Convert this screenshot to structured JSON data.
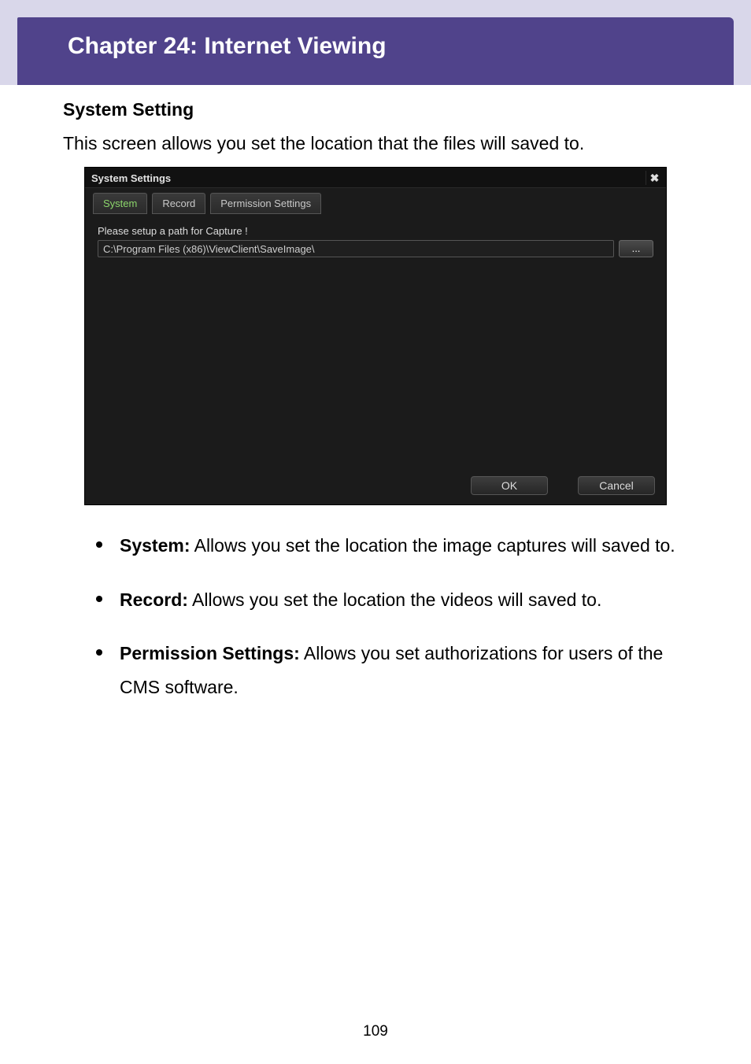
{
  "chapter": {
    "title": "Chapter 24: Internet Viewing"
  },
  "section": {
    "heading": "System Setting",
    "intro": "This screen allows you set the location that the files will saved to."
  },
  "dialog": {
    "title": "System Settings",
    "close_glyph": "✖",
    "tabs": [
      {
        "label": "System",
        "active": true
      },
      {
        "label": "Record",
        "active": false
      },
      {
        "label": "Permission Settings",
        "active": false
      }
    ],
    "capture_label": "Please setup a path for Capture !",
    "path_value": "C:\\Program Files (x86)\\ViewClient\\SaveImage\\",
    "browse_label": "...",
    "ok_label": "OK",
    "cancel_label": "Cancel"
  },
  "bullets": [
    {
      "term": "System:",
      "desc": " Allows you set the location the image captures will saved to."
    },
    {
      "term": "Record:",
      "desc": " Allows you set the location the videos will saved to."
    },
    {
      "term": "Permission Settings:",
      "desc": " Allows you set authorizations for users of the CMS software."
    }
  ],
  "page_number": "109"
}
